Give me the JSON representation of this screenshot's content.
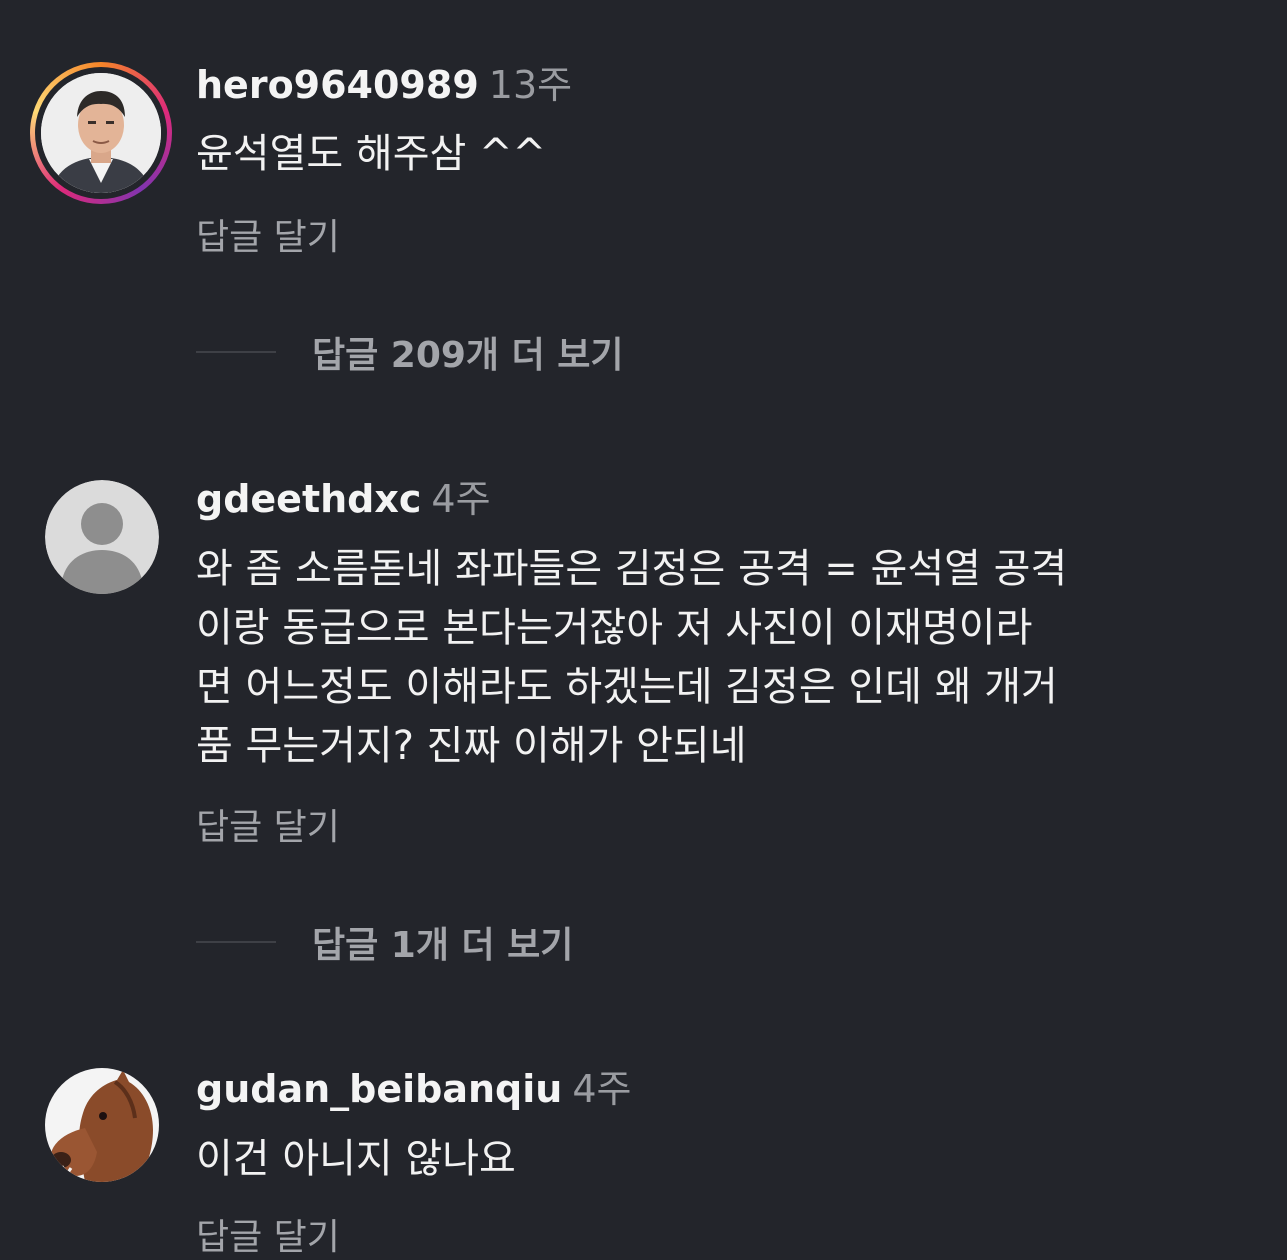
{
  "comments": [
    {
      "username": "hero9640989",
      "time": "13주",
      "text": "윤석열도 해주삼 ^^",
      "reply_label": "답글 달기",
      "more_replies": "답글 209개 더 보기"
    },
    {
      "username": "gdeethdxc",
      "time": "4주",
      "text_lines": [
        "와 좀 소름돋네 좌파들은 김정은 공격 = 윤석열 공격",
        "이랑 동급으로 본다는거잖아 저 사진이 이재명이라",
        "면 어느정도 이해라도 하겠는데 김정은 인데 왜 개거",
        "품 무는거지? 진짜 이해가 안되네"
      ],
      "reply_label": "답글 달기",
      "more_replies": "답글 1개 더 보기"
    },
    {
      "username": "gudan_beibanqiu",
      "time": "4주",
      "text": "이건 아니지 않나요",
      "reply_label": "답글 달기"
    }
  ],
  "colors": {
    "background": "#23252b",
    "text": "#f2f2f2",
    "muted": "#a3a5aa"
  }
}
